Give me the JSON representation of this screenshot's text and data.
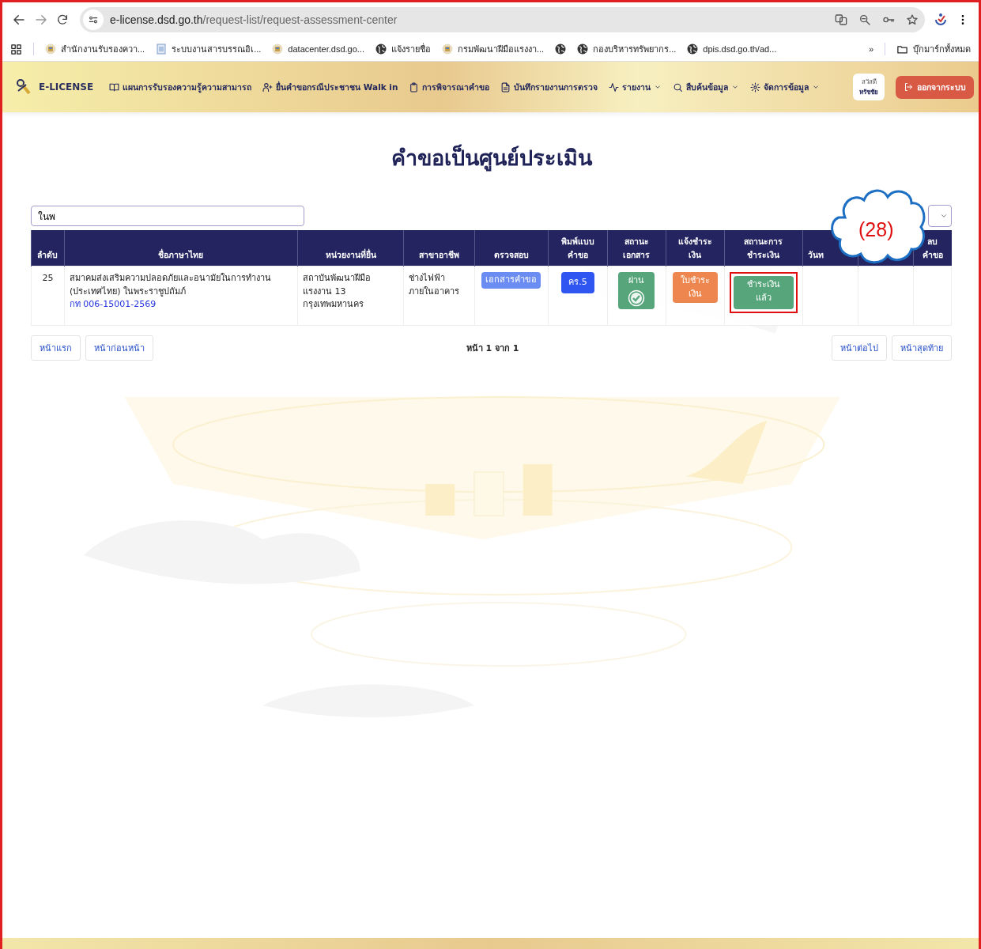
{
  "browser": {
    "url_host": "e-license.dsd.go.th",
    "url_path": "/request-list/request-assessment-center"
  },
  "bookmarks": [
    {
      "kind": "seal",
      "label": "สำนักงานรับรองควา..."
    },
    {
      "kind": "doc",
      "label": "ระบบงานสารบรรณอิเ..."
    },
    {
      "kind": "seal",
      "label": "datacenter.dsd.go..."
    },
    {
      "kind": "globe",
      "label": "แจ้งรายชื่อ"
    },
    {
      "kind": "seal",
      "label": "กรมพัฒนาฝีมือแรงงา..."
    },
    {
      "kind": "globe"
    },
    {
      "kind": "globe",
      "label": "กองบริหารทรัพยากร..."
    },
    {
      "kind": "globe",
      "label": "dpis.dsd.go.th/ad..."
    }
  ],
  "bookmarks_more": "»",
  "all_bookmarks": "บุ๊กมาร์กทั้งหมด",
  "nav": {
    "brand": "E-LICENSE",
    "items": [
      {
        "label": "แผนการรับรองความรู้ความสามารถ",
        "dropdown": false
      },
      {
        "label": "ยื่นคำขอกรณีประชาชน Walk in",
        "dropdown": false
      },
      {
        "label": "การพิจารณาคำขอ",
        "dropdown": false
      },
      {
        "label": "บันทึกรายงานการตรวจ",
        "dropdown": false
      },
      {
        "label": "รายงาน",
        "dropdown": true
      },
      {
        "label": "สืบค้นข้อมูล",
        "dropdown": true
      },
      {
        "label": "จัดการข้อมูล",
        "dropdown": true
      }
    ],
    "greeting": "สวัสดี",
    "user": "หรัชชัย",
    "logout": "ออกจากระบบ"
  },
  "title": "คำขอเป็นศูนย์ประเมิน",
  "search": {
    "value": "ในพ"
  },
  "table": {
    "columns": [
      {
        "label": "ลำดับ"
      },
      {
        "label": "ชื่อภาษาไทย"
      },
      {
        "label": "หน่วยงานที่ยื่น"
      },
      {
        "label": "สาขาอาชีพ"
      },
      {
        "label": "ตรวจสอบ"
      },
      {
        "label": "พิมพ์แบบ\nคำขอ"
      },
      {
        "label": "สถานะ\nเอกสาร"
      },
      {
        "label": "แจ้งชำระ\nเงิน"
      },
      {
        "label": "สถานะการ\nชำระเงิน"
      },
      {
        "label": "วันท"
      },
      {},
      {
        "label": "ลบ\nคำขอ"
      }
    ],
    "rows": [
      {
        "index": "25",
        "name": "สมาคมส่งเสริมความปลอดภัยและอนามัยในการทำงาน (ประเทศไทย) ในพระราชูปถัมภ์",
        "code": "กท 006-15001-2569",
        "agency": "สถาบันพัฒนาฝีมือ\nแรงงาน 13\nกรุงเทพมหานคร",
        "field": "ช่างไฟฟ้า\nภายในอาคาร",
        "check": "เอกสารคำขอ",
        "form": "คร.5",
        "doc_status": {
          "label": "ผ่าน",
          "checked": true
        },
        "payment_notice": "ใบชำระ\nเงิน",
        "payment_status": {
          "label": "ชำระเงิน\nแล้ว",
          "highlighted": true
        }
      }
    ]
  },
  "pagination": {
    "first": "หน้าแรก",
    "prev": "หน้าก่อนหน้า",
    "info": "หน้า 1 จาก 1",
    "next": "หน้าต่อไป",
    "last": "หน้าสุดท้าย"
  },
  "annotation": {
    "label": "(28)"
  }
}
